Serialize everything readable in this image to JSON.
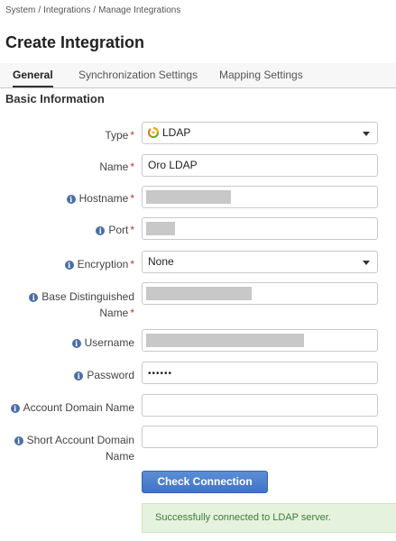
{
  "breadcrumb": [
    "System",
    "Integrations",
    "Manage Integrations"
  ],
  "page_title": "Create Integration",
  "tabs": [
    "General",
    "Synchronization Settings",
    "Mapping Settings"
  ],
  "active_tab": "General",
  "section_title": "Basic Information",
  "form": {
    "type": {
      "label": "Type",
      "required": true,
      "value": "LDAP",
      "icon": "ldap-logo-icon"
    },
    "name": {
      "label": "Name",
      "required": true,
      "value": "Oro LDAP"
    },
    "hostname": {
      "label": "Hostname",
      "required": true,
      "redacted": true
    },
    "port": {
      "label": "Port",
      "required": true,
      "redacted": true
    },
    "encryption": {
      "label": "Encryption",
      "required": true,
      "value": "None"
    },
    "base_dn": {
      "label_line1": "Base Distinguished",
      "label_line2": "Name",
      "required": true,
      "redacted": true
    },
    "username": {
      "label": "Username",
      "required": false,
      "redacted": true
    },
    "password": {
      "label": "Password",
      "required": false,
      "value": "••••••"
    },
    "account_domain_name": {
      "label": "Account Domain Name",
      "value": ""
    },
    "short_account_domain_name": {
      "label_line1": "Short Account Domain",
      "label_line2": "Name",
      "value": ""
    }
  },
  "required_marker": "*",
  "info_glyph": "i",
  "check_button": "Check Connection",
  "alert": {
    "text": "Successfully connected to LDAP server.",
    "type": "success"
  },
  "colors": {
    "primary_button": "#3f74c4",
    "success_bg": "#e5f2dd",
    "success_text": "#3f7d3a",
    "required": "#c0392b",
    "info_icon": "#4a6fa5"
  }
}
